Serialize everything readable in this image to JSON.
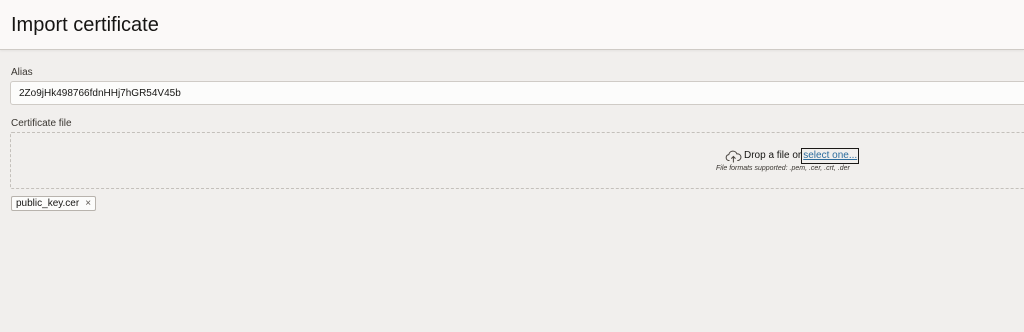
{
  "header": {
    "title": "Import certificate"
  },
  "alias": {
    "label": "Alias",
    "value": "2Zo9jHk498766fdnHHj7hGR54V45b"
  },
  "certificate": {
    "label": "Certificate file",
    "drop_text": "Drop a file or",
    "select_link": "select one...",
    "formats": "File formats supported: .pem, .cer, .crt, .der",
    "upload_icon": "cloud-upload-icon"
  },
  "files": [
    {
      "name": "public_key.cer",
      "remove": "×"
    }
  ],
  "colors": {
    "link": "#2d6d9e",
    "background": "#f1efed",
    "header": "#fbf9f8"
  }
}
